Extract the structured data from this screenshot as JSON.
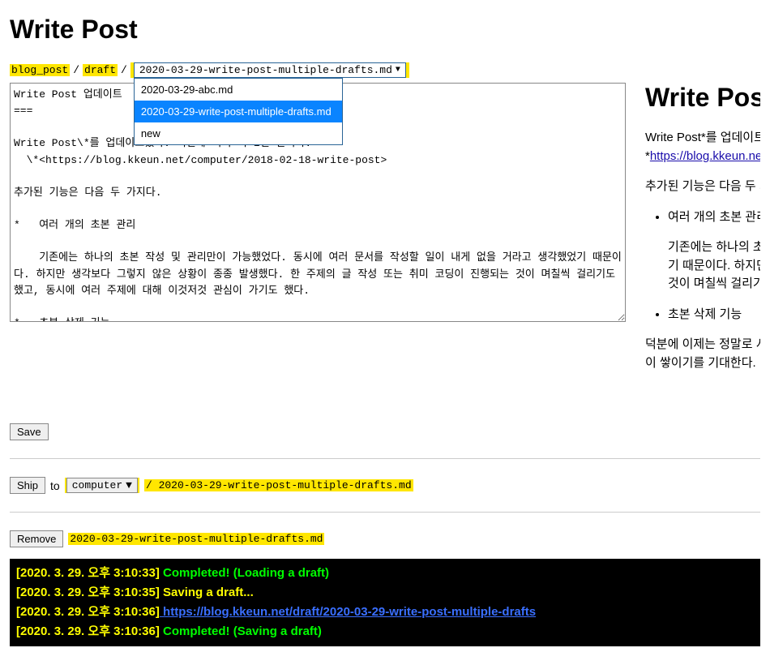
{
  "page_title": "Write Post",
  "breadcrumb": {
    "seg1": "blog_post",
    "sep": "/",
    "seg2": "draft",
    "selected_file": "2020-03-29-write-post-multiple-drafts.md"
  },
  "dropdown": {
    "options": [
      "2020-03-29-abc.md",
      "2020-03-29-write-post-multiple-drafts.md",
      "new"
    ],
    "active_index": 1
  },
  "editor_text": "Write Post 업데이트\n===\n\nWrite Post\\*를 업데이트했다. 저번에 이어 딱 1년 만이다.\n  \\*<https://blog.kkeun.net/computer/2018-02-18-write-post>\n\n추가된 기능은 다음 두 가지다.\n\n*   여러 개의 초본 관리\n\n    기존에는 하나의 초본 작성 및 관리만이 가능했었다. 동시에 여러 문서를 작성할 일이 내게 없을 거라고 생각했었기 때문이다. 하지만 생각보다 그렇지 않은 상황이 종종 발생했다. 한 주제의 글 작성 또는 취미 코딩이 진행되는 것이 며칠씩 걸리기도 했고, 동시에 여러 주제에 대해 이것저것 관심이 가기도 했다.\n\n*   초본 삭제 기능\n\n덕분에 이제는 정말로 서버에 직접 접속하지 않아도 블로그를 할 수 있을 것 같다. 더 다양한 주제들로 더 다양한 글들이 쌓이기를 기대한다.",
  "preview": {
    "title": "Write Post",
    "p1_a": "Write Post*를 업데이트",
    "p1_b": "*",
    "link_text": "https://blog.kkeun.ne",
    "p2": "추가된 기능은 다음 두 가",
    "li1": "여러 개의 초본 관리",
    "li1_sub_a": "기존에는 하나의 초",
    "li1_sub_b": "기 때문이다. 하지만",
    "li1_sub_c": "것이 며칠씩 걸리기",
    "li2": "초본 삭제 기능",
    "p3_a": "덕분에 이제는 정말로 서버",
    "p3_b": "이 쌓이기를 기대한다."
  },
  "buttons": {
    "save": "Save",
    "ship": "Ship",
    "remove": "Remove"
  },
  "ship": {
    "to_label": "to",
    "dest": "computer",
    "path_sep": "/",
    "filename": "2020-03-29-write-post-multiple-drafts.md"
  },
  "remove": {
    "filename": "2020-03-29-write-post-multiple-drafts.md"
  },
  "console": {
    "lines": [
      {
        "ts": "[2020. 3. 29. 오후 3:10:33]",
        "msg": " Completed! (Loading a draft)",
        "cls": "msg-green"
      },
      {
        "ts": "[2020. 3. 29. 오후 3:10:35]",
        "msg": " Saving a draft...",
        "cls": "msg-yellow"
      },
      {
        "ts": "[2020. 3. 29. 오후 3:10:36]",
        "link": " https://blog.kkeun.net/draft/2020-03-29-write-post-multiple-drafts"
      },
      {
        "ts": "[2020. 3. 29. 오후 3:10:36]",
        "msg": " Completed! (Saving a draft)",
        "cls": "msg-green"
      }
    ]
  }
}
